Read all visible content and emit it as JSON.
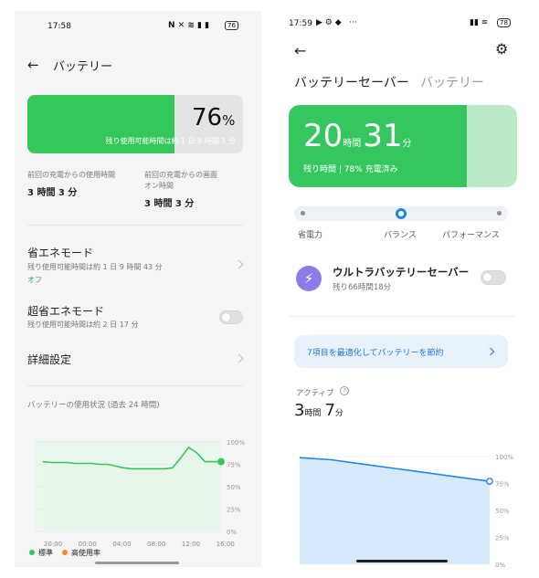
{
  "left": {
    "status": {
      "time": "17:58",
      "battery": "76"
    },
    "header": {
      "title": "バッテリー"
    },
    "battery": {
      "level_percent": 76,
      "percent_text": "76",
      "percent_sign": "%",
      "remaining": "残り使用可能時間は約 1 日 8 時間 1 分"
    },
    "usage": {
      "since_charge_label": "前回の充電からの使用時間",
      "since_charge_value": "3 時間 3 分",
      "screen_on_label_1": "前回の充電からの画面",
      "screen_on_label_2": "オン時間",
      "screen_on_value": "3 時間 3 分"
    },
    "power_saving": {
      "title": "省エネモード",
      "subtitle": "残り使用可能時間は約 1 日 9 時間 43 分",
      "state": "オフ"
    },
    "super_saving": {
      "title": "超省エネモード",
      "subtitle": "残り使用可能時間は約 2 日 17 分"
    },
    "details": {
      "title": "詳細設定"
    },
    "chart": {
      "title": "バッテリーの使用状況 (過去 24 時間)",
      "legend_standard": "標準",
      "legend_high": "高使用率",
      "colors": {
        "line": "#34c759",
        "area": "#e8f6ea",
        "high": "#f08a24"
      }
    }
  },
  "right": {
    "status": {
      "time": "17:59",
      "dots": "···",
      "battery": "78"
    },
    "tabs": {
      "active": "バッテリーセーバー",
      "inactive": "バッテリー"
    },
    "battery": {
      "level_percent": 78,
      "hours": "20",
      "hours_unit": "時間",
      "minutes": "31",
      "minutes_unit": "分",
      "sub": "残り時間 | 78% 充電済み"
    },
    "modes": {
      "saver": "省電力",
      "balance": "バランス",
      "performance": "パフォーマンス",
      "selected_index": 1
    },
    "ultra": {
      "title": "ウルトラバッテリーセーバー",
      "subtitle": "残り66時間18分"
    },
    "optimize": {
      "text": "7項目を最適化してバッテリーを節約"
    },
    "active": {
      "label": "アクティブ",
      "hours": "3",
      "hours_unit": "時間",
      "minutes": "7",
      "minutes_unit": "分"
    },
    "chart": {
      "colors": {
        "line": "#1e88e5",
        "area": "#cfe6fb"
      }
    }
  },
  "chart_data": [
    {
      "type": "area",
      "x_ticks": [
        "20:00",
        "00:00",
        "04:00",
        "08:00",
        "12:00",
        "16:00"
      ],
      "y_ticks": [
        "100%",
        "75%",
        "50%",
        "25%",
        "0%"
      ],
      "ylim": [
        0,
        100
      ],
      "series": [
        {
          "name": "標準",
          "x": [
            0,
            1,
            2,
            3,
            4,
            5,
            6,
            7,
            8,
            9,
            10,
            11,
            12,
            13,
            14,
            15,
            16,
            17,
            18,
            19,
            20,
            21,
            22
          ],
          "values": [
            78,
            77,
            77,
            77,
            76,
            76,
            76,
            75,
            75,
            73,
            71,
            70,
            70,
            70,
            70,
            70,
            71,
            82,
            94,
            88,
            78,
            78,
            78
          ]
        }
      ],
      "x_range": [
        -1,
        22
      ]
    },
    {
      "type": "area",
      "y_ticks": [
        "100%",
        "75%",
        "50%",
        "25%",
        "0%"
      ],
      "ylim": [
        0,
        100
      ],
      "series": [
        {
          "x": [
            0,
            1,
            2,
            3,
            4,
            5,
            6
          ],
          "values": [
            99,
            97,
            93,
            89,
            85,
            81,
            77
          ]
        }
      ],
      "x_range": [
        0,
        6
      ]
    }
  ]
}
